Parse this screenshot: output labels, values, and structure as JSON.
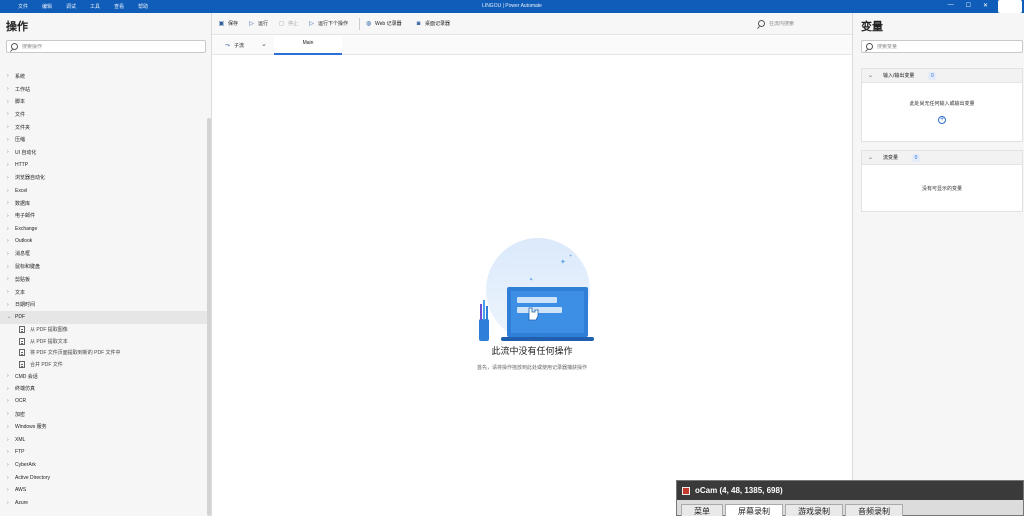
{
  "titlebar": {
    "menu": [
      "文件",
      "编辑",
      "调试",
      "工具",
      "查看",
      "帮助"
    ],
    "title": "LINGOU | Power Automate",
    "controls": [
      "—",
      "☐",
      "✕"
    ]
  },
  "actions_panel": {
    "title": "操作",
    "search_placeholder": "搜索操作",
    "categories_before": [
      "系统",
      "工作站",
      "脚本",
      "文件",
      "文件夹",
      "压缩",
      "UI 自动化",
      "HTTP",
      "浏览器自动化",
      "Excel",
      "数据库",
      "电子邮件",
      "Exchange",
      "Outlook",
      "消息框",
      "鼠标和键盘",
      "剪贴板",
      "文本",
      "日期时间"
    ],
    "expanded_category": "PDF",
    "pdf_actions": [
      "从 PDF 提取图像",
      "从 PDF 提取文本",
      "将 PDF 文件页面提取到新的 PDF 文件中",
      "合并 PDF 文件"
    ],
    "categories_after": [
      "CMD 会话",
      "终端仿真",
      "OCR",
      "加密",
      "Windows 服务",
      "XML",
      "FTP",
      "CyberArk",
      "Active Directory",
      "AWS",
      "Azure"
    ]
  },
  "toolbar": {
    "save": "保存",
    "run": "运行",
    "stop": "停止",
    "run_next": "运行下个操作",
    "web_recorder": "Web 记录器",
    "desktop_recorder": "桌面记录器",
    "search_placeholder": "在流内搜索"
  },
  "tabs": {
    "subflow": "子流",
    "main": "Main"
  },
  "empty_state": {
    "title": "此流中没有任何操作",
    "hint": "首先，请将操作拖放到此处或使用记录器捕获操作"
  },
  "variables_panel": {
    "title": "变量",
    "search_placeholder": "搜索变量",
    "io_section": {
      "title": "输入/输出变量",
      "count": "0",
      "empty": "此处尚无任何输入或输出变量"
    },
    "flow_section": {
      "title": "流变量",
      "count": "0",
      "empty": "没有可显示的变量"
    }
  },
  "ocam": {
    "title": "oCam (4, 48, 1385, 698)",
    "tabs": [
      "菜单",
      "屏幕录制",
      "游戏录制",
      "音频录制"
    ]
  },
  "colors": {
    "titlebar": "#0f5db8",
    "accent": "#2a6fd6"
  }
}
